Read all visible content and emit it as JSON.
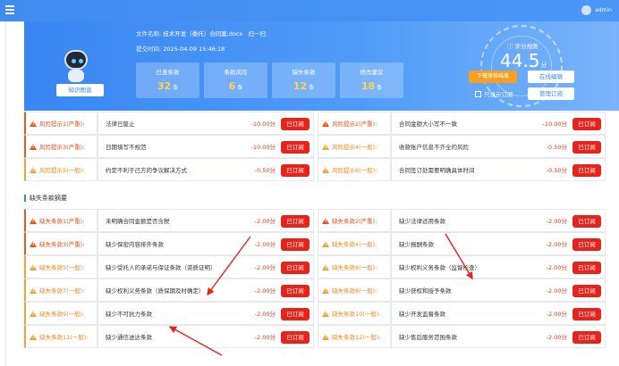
{
  "header": {
    "user_name": "admin"
  },
  "hero": {
    "kb_button": "知识图谱",
    "file_label": "文件名称:",
    "file_name": "技术开发（委托）合同案.docx",
    "file_action": "扫一扫",
    "time_label": "提交时间:",
    "time_value": "2025-04-09 15:46:18",
    "stats": [
      {
        "label": "已查条款",
        "value": "32",
        "unit": "条"
      },
      {
        "label": "条款风险",
        "value": "6",
        "unit": "条"
      },
      {
        "label": "缺失条款",
        "value": "12",
        "unit": "条"
      },
      {
        "label": "修改建议",
        "value": "18",
        "unit": "条"
      }
    ],
    "score_title": "评分规则",
    "score_value": "44.5",
    "score_unit": "分",
    "download_button": "下载审核结果",
    "online_edit_button": "在线编辑",
    "only_subscribed_label": "只显示订阅",
    "manage_subscribe_button": "管理订阅"
  },
  "risk_rows": [
    {
      "left_label": "风险提示1(严重):",
      "left_desc": "法律已废止",
      "left_score": "-10.00分",
      "right_label": "风险提示2(严重):",
      "right_desc": "合同金额大小写不一致",
      "right_score": "-10.00分",
      "left_severity": "severe",
      "right_severity": "severe"
    },
    {
      "left_label": "风险提示3(严重):",
      "left_desc": "日期填写不规范",
      "left_score": "-10.00分",
      "right_label": "风险提示4(一般):",
      "right_desc": "收款账户信息不齐全的风险",
      "right_score": "-0.50分",
      "left_severity": "severe",
      "right_severity": "normal"
    },
    {
      "left_label": "风险提示5(一般):",
      "left_desc": "约定不利于己方的争议解决方式",
      "left_score": "-0.50分",
      "right_label": "风险提示6(一般):",
      "right_desc": "合同签订处需要明确具体时间",
      "right_score": "-0.50分",
      "left_severity": "normal",
      "right_severity": "normal"
    }
  ],
  "missing_title": "缺失条款摘要",
  "missing_rows": [
    {
      "left_label": "缺失条款1(严重):",
      "left_desc": "未明确合同金额是否含税",
      "left_score": "-2.00分",
      "right_label": "缺失条款2(严重):",
      "right_desc": "缺少法律适用条款",
      "right_score": "-2.00分",
      "left_severity": "severe",
      "right_severity": "severe"
    },
    {
      "left_label": "缺失条款3(严重):",
      "left_desc": "缺少保密内容排外条款",
      "left_score": "-2.00分",
      "right_label": "缺失条款4(一般):",
      "right_desc": "缺少报酬条款",
      "right_score": "-2.00分",
      "left_severity": "severe",
      "right_severity": "normal"
    },
    {
      "left_label": "缺失条款5(一般):",
      "left_desc": "缺少受托人的承诺与保证条款（资质证明）",
      "left_score": "-2.00分",
      "right_label": "缺失条款6(一般):",
      "right_desc": "缺少权利义务条款（监督检查）",
      "right_score": "-2.00分",
      "left_severity": "normal",
      "right_severity": "normal"
    },
    {
      "left_label": "缺失条款7(一般):",
      "left_desc": "缺少权利义务条款（质保期及时确定）",
      "left_score": "-2.00分",
      "right_label": "缺失条款8(一般):",
      "right_desc": "缺少获权和授予条款",
      "right_score": "-2.00分",
      "left_severity": "normal",
      "right_severity": "normal"
    },
    {
      "left_label": "缺失条款9(一般):",
      "left_desc": "缺少不可抗力条款",
      "left_score": "-2.00分",
      "right_label": "缺失条款10(一般):",
      "right_desc": "缺少开发监督条款",
      "right_score": "-2.00分",
      "left_severity": "normal",
      "right_severity": "normal"
    },
    {
      "left_label": "缺失条款11(一般):",
      "left_desc": "缺少通信送达条款",
      "left_score": "-2.00分",
      "right_label": "缺失条款12(一般):",
      "right_desc": "缺少售后服务范围条款",
      "right_score": "-2.00分",
      "left_severity": "normal",
      "right_severity": "normal"
    }
  ],
  "subscribed_label": "已订阅",
  "colors": {
    "accent": "#3a86f2",
    "danger": "#e8231c",
    "warning": "#f3a13a",
    "orange_button": "#f4a020"
  }
}
